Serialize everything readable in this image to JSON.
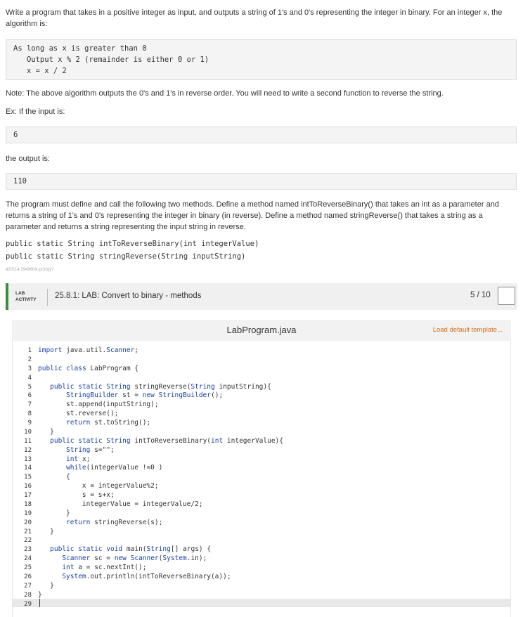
{
  "intro": "Write a program that takes in a positive integer as input, and outputs a string of 1's and 0's representing the integer in binary. For an integer x, the algorithm is:",
  "algorithm": [
    "As long as x is greater than 0",
    "   Output x % 2 (remainder is either 0 or 1)",
    "   x = x / 2"
  ],
  "note": "Note: The above algorithm outputs the 0's and 1's in reverse order. You will need to write a second function to reverse the string.",
  "example_label": "Ex: If the input is:",
  "example_input": "6",
  "output_label": "the output is:",
  "example_output": "110",
  "methods_description": "The program must define and call the following two methods. Define a method named intToReverseBinary() that takes an int as a parameter and returns a string of 1's and 0's representing the integer in binary (in reverse). Define a method named stringReverse() that takes a string as a parameter and returns a string representing the input string in reverse.",
  "signatures": [
    "public static String intToReverseBinary(int integerValue)",
    "public static String stringReverse(String inputString)"
  ],
  "item_id": "420114.2949604.qx3zqy7",
  "lab": {
    "badge_line1": "LAB",
    "badge_line2": "ACTIVITY",
    "title": "25.8.1: LAB: Convert to binary - methods",
    "score": "5 / 10",
    "accent_color": "#3d8b3d"
  },
  "editor": {
    "file_name": "LabProgram.java",
    "load_template": "Load default template...",
    "line_numbers": [
      "1",
      "2",
      "3",
      "4",
      "5",
      "6",
      "7",
      "8",
      "9",
      "10",
      "11",
      "12",
      "13",
      "14",
      "15",
      "16",
      "17",
      "18",
      "19",
      "20",
      "21",
      "22",
      "23",
      "24",
      "25",
      "26",
      "27",
      "28",
      "29"
    ],
    "lines": [
      "import java.util.Scanner;",
      "",
      "public class LabProgram {",
      "",
      "   public static String stringReverse(String inputString){",
      "       StringBuilder st = new StringBuilder();",
      "       st.append(inputString);",
      "       st.reverse();",
      "       return st.toString();",
      "   }",
      "   public static String intToReverseBinary(int integerValue){",
      "       String s=\"\";",
      "       int x;",
      "       while(integerValue !=0 )",
      "       {",
      "           x = integerValue%2;",
      "           s = s+x;",
      "           integerValue = integerValue/2;",
      "       }",
      "       return stringReverse(s);",
      "   }",
      "",
      "   public static void main(String[] args) {",
      "      Scanner sc = new Scanner(System.in);",
      "      int a = sc.nextInt();",
      "      System.out.println(intToReverseBinary(a));",
      "   }",
      "}",
      ""
    ]
  }
}
